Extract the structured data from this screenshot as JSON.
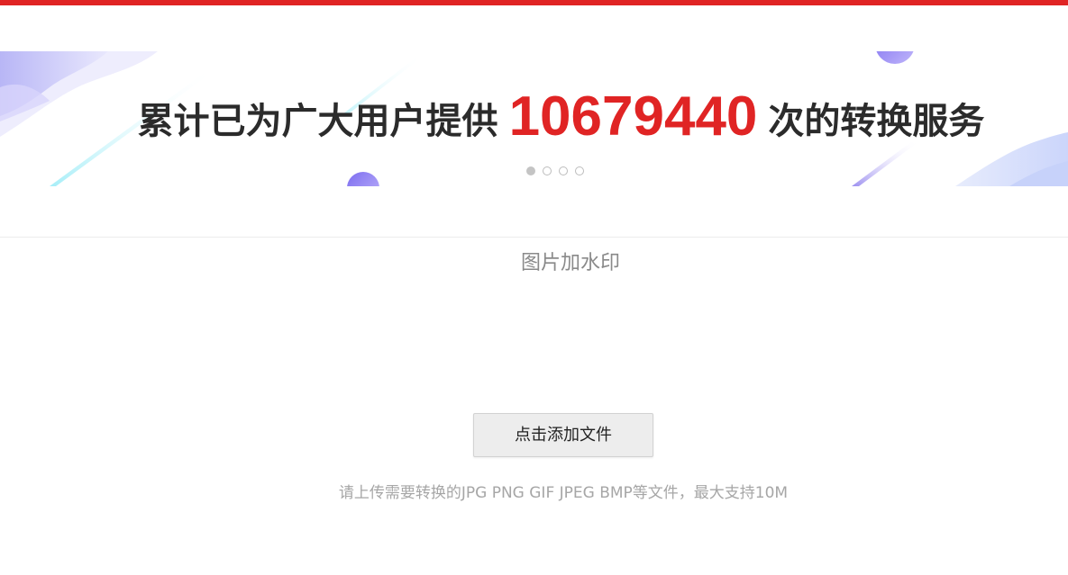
{
  "colors": {
    "top_bar": "#e02424",
    "accent_red": "#e02424",
    "banner_text": "#2b2b2b"
  },
  "banner": {
    "text_before": "累计已为广大用户提供",
    "count": "10679440",
    "text_after": "次的转换服务",
    "carousel": {
      "total_slides": 4,
      "active_index": 0
    }
  },
  "main": {
    "title": "图片加水印",
    "upload_button_label": "点击添加文件",
    "hint": "请上传需要转换的JPG PNG GIF JPEG BMP等文件，最大支持10M"
  }
}
